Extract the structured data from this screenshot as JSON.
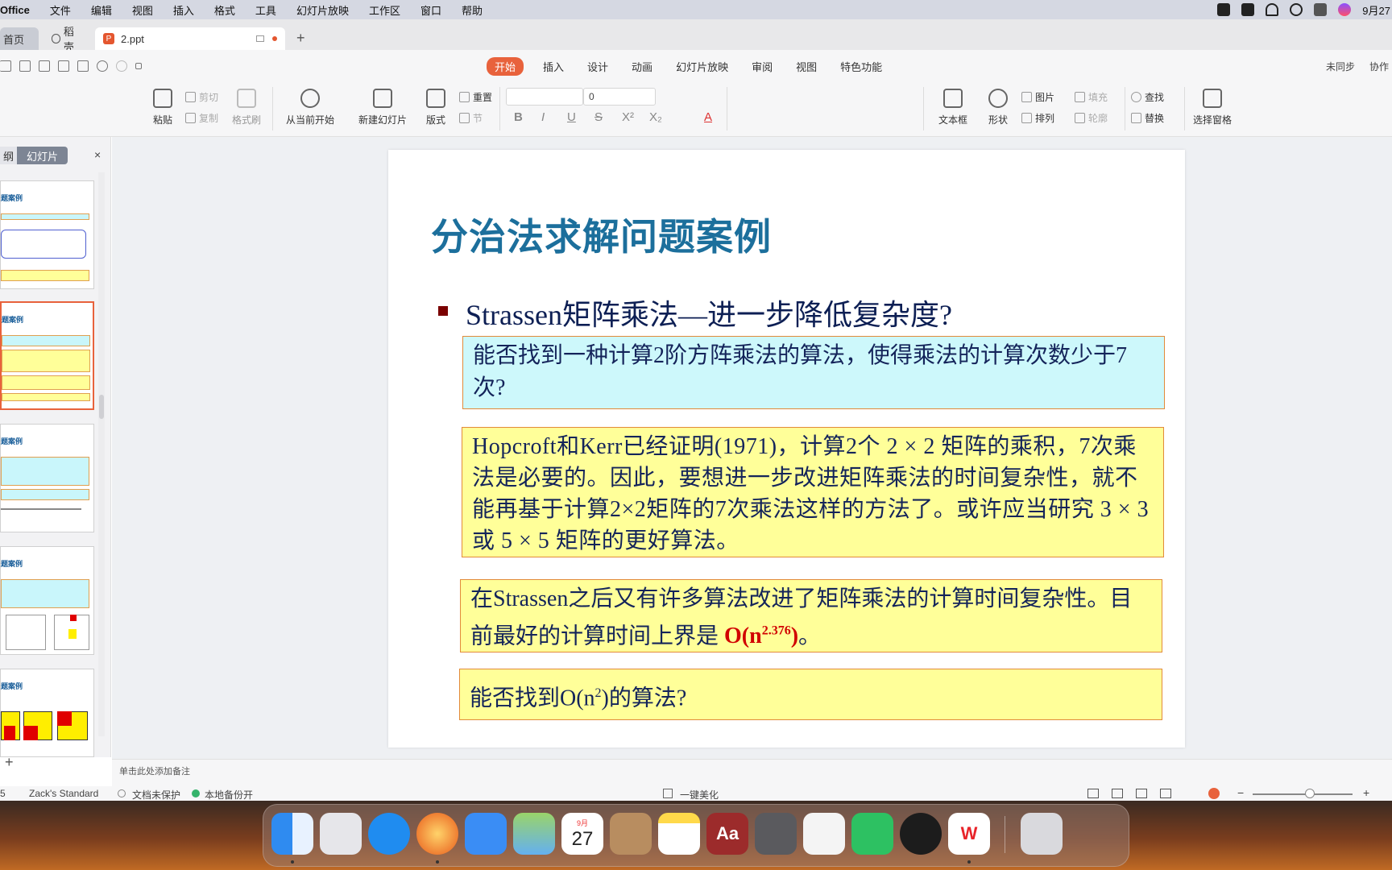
{
  "menubar": {
    "app": "Office",
    "items": [
      "文件",
      "编辑",
      "视图",
      "插入",
      "格式",
      "工具",
      "幻灯片放映",
      "工作区",
      "窗口",
      "帮助"
    ],
    "date": "9月27"
  },
  "tabs": {
    "home": "首页",
    "docer": "稻壳",
    "active": "2.ppt"
  },
  "ribbon_tabs": [
    "开始",
    "插入",
    "设计",
    "动画",
    "幻灯片放映",
    "审阅",
    "视图",
    "特色功能"
  ],
  "ribbon_right": {
    "sync": "未同步",
    "collab": "协作"
  },
  "ribbon": {
    "paste": "粘贴",
    "cut": "剪切",
    "copy": "复制",
    "format_painter": "格式刷",
    "play_from_current": "从当前开始",
    "new_slide": "新建幻灯片",
    "layout": "版式",
    "reset": "重置",
    "section": "节",
    "font_size": "0",
    "text_box": "文本框",
    "shape": "形状",
    "picture": "图片",
    "fill": "填充",
    "arrange": "排列",
    "outline": "轮廓",
    "find": "查找",
    "replace": "替换",
    "select_pane": "选择窗格"
  },
  "left_panel": {
    "tab_outline": "纲",
    "tab_slides": "幻灯片",
    "close": "×",
    "add": "+",
    "thumb_title": "题案例"
  },
  "slide": {
    "title": "分治法求解问题案例",
    "bullet": "Strassen矩阵乘法—进一步降低复杂度?",
    "box1": "能否找到一种计算2阶方阵乘法的算法，使得乘法的计算次数少于7次?",
    "box2": "Hopcroft和Kerr已经证明(1971)，计算2个 2 × 2 矩阵的乘积，7次乘法是必要的。因此，要想进一步改进矩阵乘法的时间复杂性，就不能再基于计算2×2矩阵的7次乘法这样的方法了。或许应当研究 3 × 3 或 5 × 5 矩阵的更好算法。",
    "box3_pre": "在Strassen之后又有许多算法改进了矩阵乘法的计算时间复杂性。目前最好的计算时间上界是 ",
    "box3_red": "O(n",
    "box3_sup": "2.376",
    "box3_red_close": ")",
    "box3_post": "。",
    "box4_pre": "能否找到O(n",
    "box4_sup": "2",
    "box4_post": ")的算法?"
  },
  "notes": "单击此处添加备注",
  "status": {
    "page": "5",
    "theme": "Zack's Standard",
    "protect": "文档未保护",
    "backup": "本地备份开",
    "beautify": "一键美化"
  },
  "dock": {
    "calendar_month": "9月",
    "calendar_day": "27",
    "dict": "Aa"
  }
}
